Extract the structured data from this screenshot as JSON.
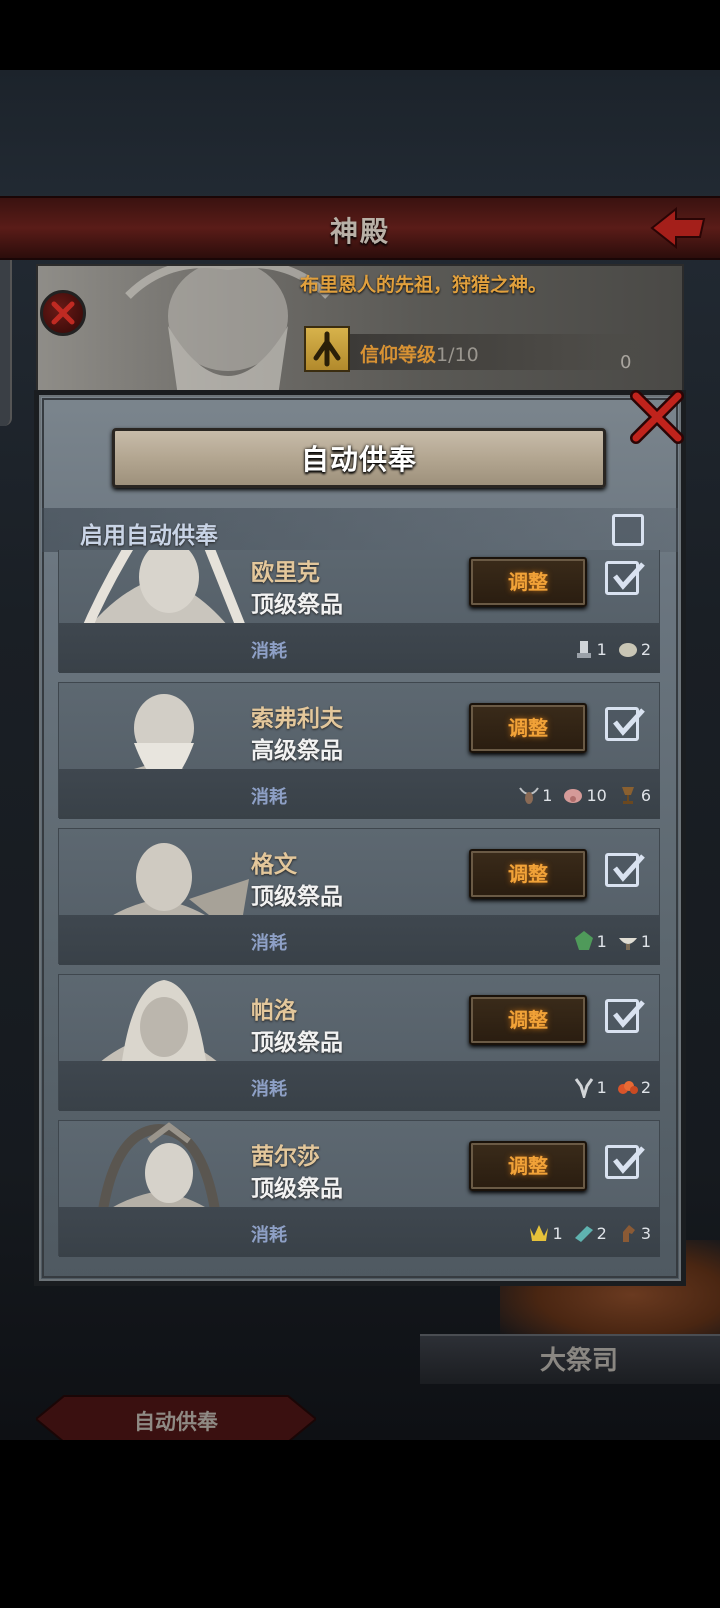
{
  "temple": {
    "title": "神殿",
    "god_description": "布里恩人的先祖，狩猎之神。",
    "faith_label": "信仰等级",
    "faith_level": "1/10",
    "faith_value": "0"
  },
  "background": {
    "high_priest_label": "大祭司",
    "auto_offer_button": "自动供奉"
  },
  "dialog": {
    "title": "自动供奉",
    "enable_label": "启用自动供奉",
    "enable_checked": false
  },
  "cards": [
    {
      "name": "欧里克",
      "tier": "顶级祭品",
      "adjust_label": "调整",
      "consume_label": "消耗",
      "checked": true,
      "costs": [
        {
          "icon": "trophy-statue-icon",
          "count": "1"
        },
        {
          "icon": "stone-egg-icon",
          "count": "2"
        }
      ]
    },
    {
      "name": "索弗利夫",
      "tier": "高级祭品",
      "adjust_label": "调整",
      "consume_label": "消耗",
      "checked": true,
      "costs": [
        {
          "icon": "horned-skull-icon",
          "count": "1"
        },
        {
          "icon": "boar-head-icon",
          "count": "10"
        },
        {
          "icon": "goblet-icon",
          "count": "6"
        }
      ]
    },
    {
      "name": "格文",
      "tier": "顶级祭品",
      "adjust_label": "调整",
      "consume_label": "消耗",
      "checked": true,
      "costs": [
        {
          "icon": "green-mask-icon",
          "count": "1"
        },
        {
          "icon": "bowl-icon",
          "count": "1"
        }
      ]
    },
    {
      "name": "帕洛",
      "tier": "顶级祭品",
      "adjust_label": "调整",
      "consume_label": "消耗",
      "checked": true,
      "costs": [
        {
          "icon": "antler-icon",
          "count": "1"
        },
        {
          "icon": "coral-icon",
          "count": "2"
        }
      ]
    },
    {
      "name": "茜尔莎",
      "tier": "顶级祭品",
      "adjust_label": "调整",
      "consume_label": "消耗",
      "checked": true,
      "costs": [
        {
          "icon": "golden-crown-icon",
          "count": "1"
        },
        {
          "icon": "crystal-bar-icon",
          "count": "2"
        },
        {
          "icon": "horse-head-icon",
          "count": "3"
        }
      ]
    }
  ]
}
